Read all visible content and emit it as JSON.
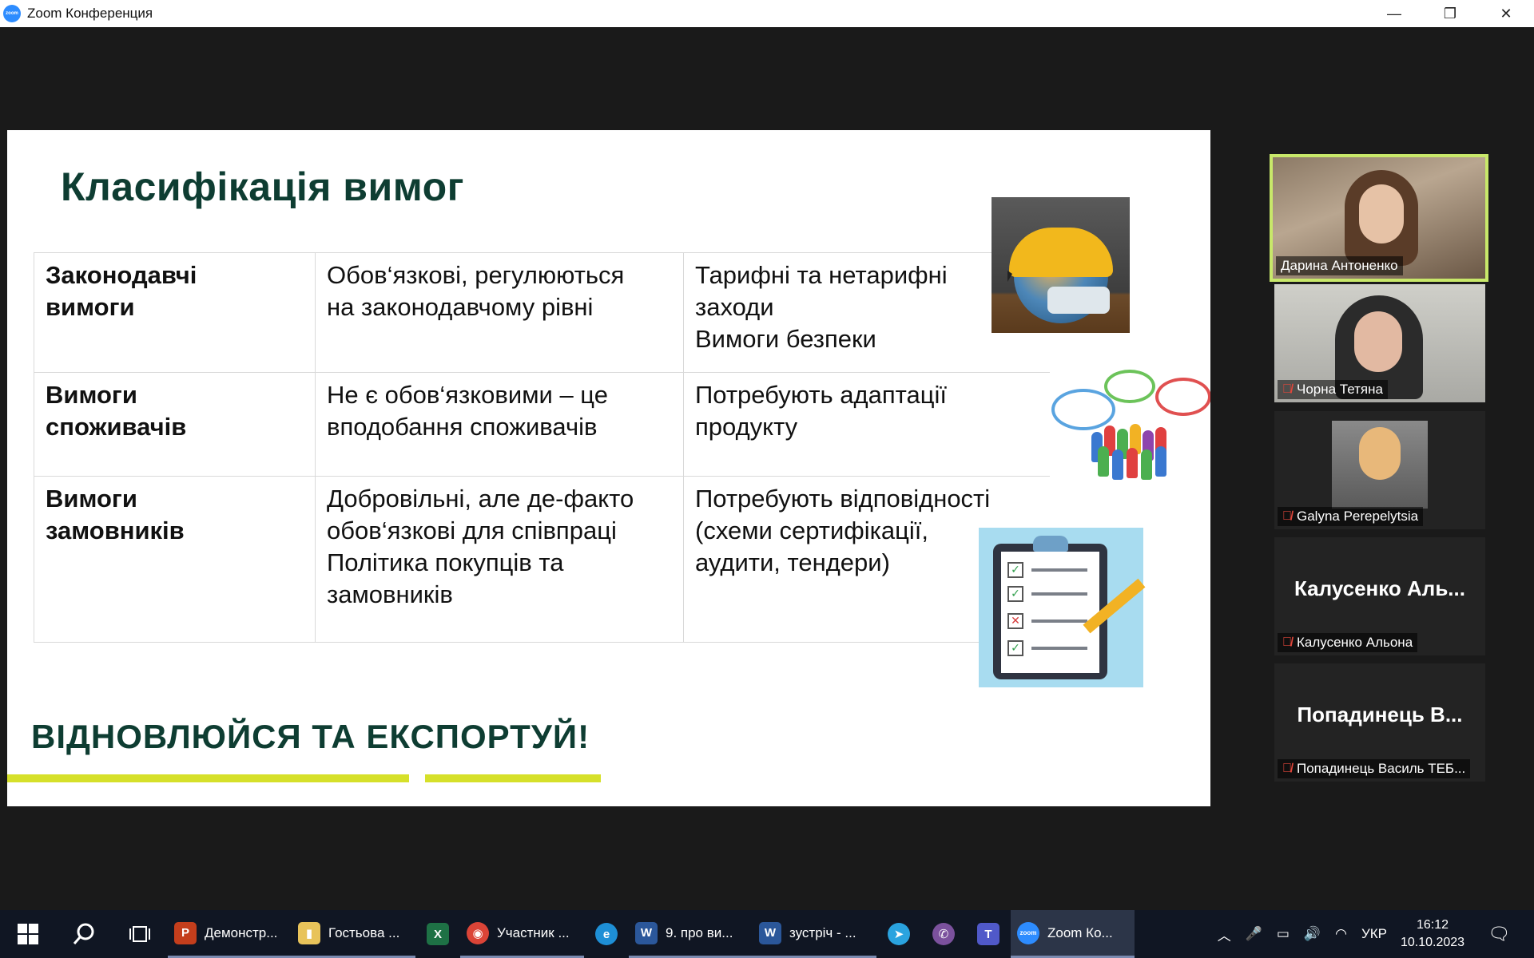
{
  "window": {
    "title": "Zoom Конференция",
    "logo_text": "zoom",
    "minimize": "—",
    "restore": "❐",
    "close": "✕"
  },
  "slide": {
    "title": "Класифікація вимог",
    "rows": [
      {
        "category": [
          "Законодавчі",
          "вимоги"
        ],
        "description": [
          "Обов‘язкові, регулюються",
          "на законодавчому рівні"
        ],
        "examples": [
          "Тарифні та нетарифні",
          "заходи",
          "Вимоги безпеки"
        ]
      },
      {
        "category": [
          "Вимоги",
          "споживачів"
        ],
        "description": [
          "Не є обов‘язковими – це",
          "вподобання споживачів"
        ],
        "examples": [
          "Потребують адаптації",
          "продукту"
        ]
      },
      {
        "category": [
          "Вимоги",
          "замовників"
        ],
        "description": [
          "Добровільні, але де-факто",
          "обов‘язкові для співпраці",
          "Політика покупців та",
          "замовників"
        ],
        "examples": [
          "Потребують відповідності",
          "(схеми сертифікації,",
          "аудити, тендери)"
        ]
      }
    ],
    "slogan": "ВІДНОВЛЮЙСЯ ТА ЕКСПОРТУЙ!"
  },
  "participants": [
    {
      "name": "Дарина Антоненко",
      "muted": false,
      "active": true,
      "video": true
    },
    {
      "name": "Чорна Тетяна",
      "muted": true,
      "active": false,
      "video": true
    },
    {
      "name": "Galyna Perepelytsia",
      "muted": true,
      "active": false,
      "video": true
    },
    {
      "name": "Калусенко Альона",
      "display": "Калусенко  Аль...",
      "muted": true,
      "active": false,
      "video": false
    },
    {
      "name": "Попадинець Василь ТЕБ...",
      "display": "Попадинець  В...",
      "muted": true,
      "active": false,
      "video": false
    }
  ],
  "taskbar": {
    "apps": [
      {
        "label": "Демонстр...",
        "glyph": "P",
        "color": "#c43e1c"
      },
      {
        "label": "Гостьова ...",
        "glyph": "▮",
        "color": "#e8c35a"
      },
      {
        "label": "",
        "glyph": "X",
        "color": "#1e7145"
      },
      {
        "label": "Участник ...",
        "glyph": "◉",
        "color": "#db4437"
      },
      {
        "label": "",
        "glyph": "e",
        "color": "#1e8fd6"
      },
      {
        "label": "9. про ви...",
        "glyph": "W",
        "color": "#2b579a"
      },
      {
        "label": "зустріч - ...",
        "glyph": "W",
        "color": "#2b579a"
      },
      {
        "label": "",
        "glyph": "➤",
        "color": "#2aa3df"
      },
      {
        "label": "",
        "glyph": "✆",
        "color": "#7b519d"
      },
      {
        "label": "",
        "glyph": "T",
        "color": "#5059c9"
      },
      {
        "label": "Zoom Ко...",
        "glyph": "zoom",
        "color": "#2d8cff"
      }
    ],
    "language": "УКР",
    "time": "16:12",
    "date": "10.10.2023"
  }
}
